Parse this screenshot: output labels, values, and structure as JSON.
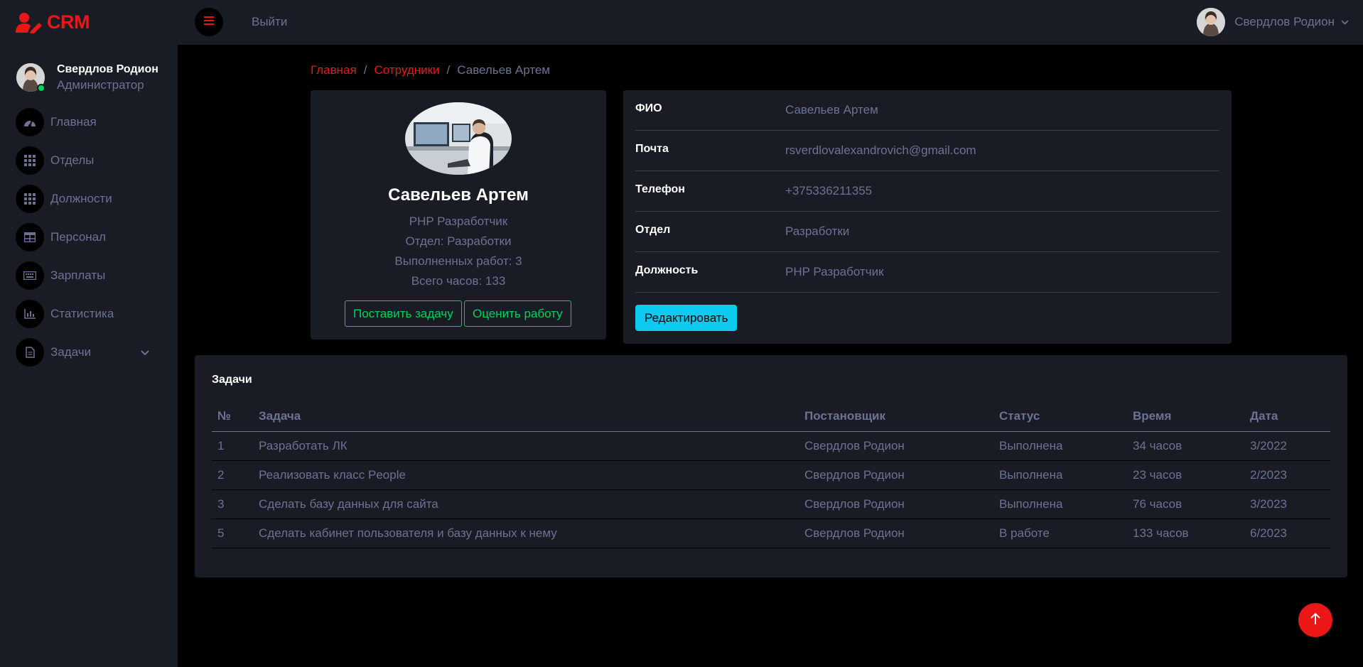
{
  "brand": {
    "name": "CRM",
    "color": "#eb1616",
    "icon": "user-edit-icon"
  },
  "profile": {
    "name": "Свердлов Родион",
    "role": "Администратор",
    "status": "online"
  },
  "sidebar": {
    "items": [
      {
        "label": "Главная",
        "icon": "dashboard-icon"
      },
      {
        "label": "Отделы",
        "icon": "grid-icon"
      },
      {
        "label": "Должности",
        "icon": "grid-icon"
      },
      {
        "label": "Персонал",
        "icon": "table-icon"
      },
      {
        "label": "Зарплаты",
        "icon": "keyboard-icon"
      },
      {
        "label": "Статистика",
        "icon": "chart-icon"
      },
      {
        "label": "Задачи",
        "icon": "file-icon"
      }
    ]
  },
  "topbar": {
    "logout": "Выйти",
    "user_name": "Свердлов Родион"
  },
  "breadcrumb": {
    "home": "Главная",
    "section": "Сотрудники",
    "current": "Савельев Артем",
    "sep": "/"
  },
  "employee": {
    "name": "Савельев Артем",
    "position": "PHP Разработчик",
    "department_line": "Отдел: Разработки",
    "works_line": "Выполненных работ: 3",
    "hours_line": "Всего часов: 133",
    "btn_assign": "Поставить задачу",
    "btn_rate": "Оценить работу"
  },
  "info": {
    "rows": [
      {
        "key": "ФИО",
        "value": "Савельев Артем"
      },
      {
        "key": "Почта",
        "value": "rsverdlovalexandrovich@gmail.com"
      },
      {
        "key": "Телефон",
        "value": "+375336211355"
      },
      {
        "key": "Отдел",
        "value": "Разработки"
      },
      {
        "key": "Должность",
        "value": "PHP Разработчик"
      }
    ],
    "edit_label": "Редактировать"
  },
  "tasks": {
    "title": "Задачи",
    "columns": [
      "№",
      "Задача",
      "Постановщик",
      "Статус",
      "Время",
      "Дата"
    ],
    "rows": [
      [
        "1",
        "Разработать ЛК",
        "Свердлов Родион",
        "Выполнена",
        "34 часов",
        "3/2022"
      ],
      [
        "2",
        "Реализовать класс People",
        "Свердлов Родион",
        "Выполнена",
        "23 часов",
        "2/2023"
      ],
      [
        "3",
        "Сделать базу данных для сайта",
        "Свердлов Родион",
        "Выполнена",
        "76 часов",
        "3/2023"
      ],
      [
        "5",
        "Сделать кабинет пользователя и базу данных к нему",
        "Свердлов Родион",
        "В работе",
        "133 часов",
        "6/2023"
      ]
    ]
  },
  "colors": {
    "accent": "#eb1616",
    "success": "#00d25b",
    "info": "#0dcaf0",
    "surface": "#191c24",
    "text_muted": "#6c7293"
  }
}
